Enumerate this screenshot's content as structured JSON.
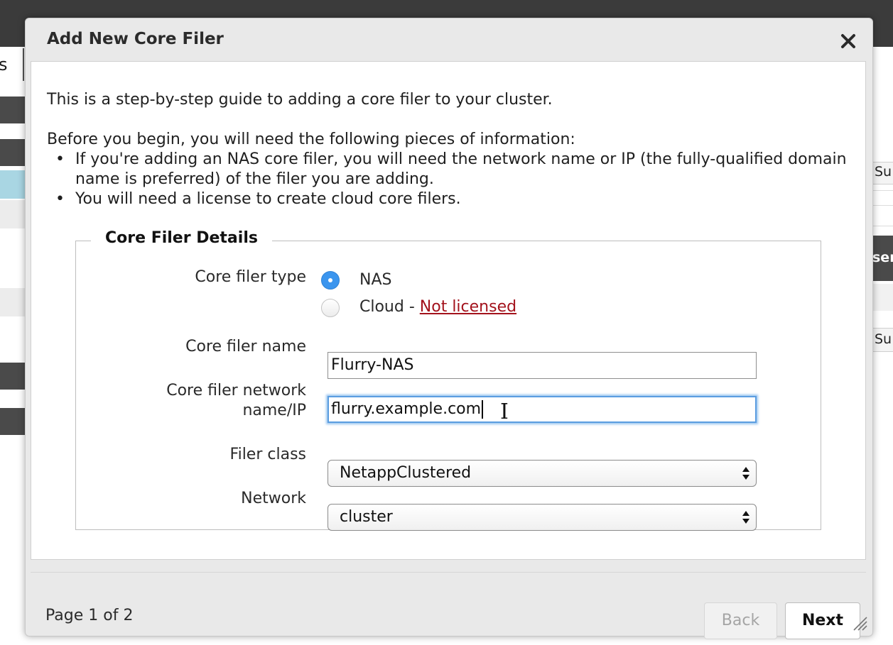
{
  "background": {
    "tab_partial": "s",
    "right_labels": [
      "Su",
      "ser",
      "Su"
    ]
  },
  "dialog": {
    "title": "Add New Core Filer",
    "close_icon": "close-icon",
    "intro": "This is a step-by-step guide to adding a core filer to your cluster.",
    "before_you_begin": "Before you begin, you will need the following pieces of information:",
    "bullets": [
      "If you're adding an NAS core filer, you will need the network name or IP (the fully-qualified domain name is preferred) of the filer you are adding.",
      "You will need a license to create cloud core filers."
    ],
    "fieldset": {
      "legend": "Core Filer Details",
      "core_filer_type": {
        "label": "Core filer type",
        "options": [
          {
            "label": "NAS",
            "selected": true
          },
          {
            "label": "Cloud - ",
            "link": "Not licensed",
            "selected": false
          }
        ]
      },
      "core_filer_name": {
        "label": "Core filer name",
        "value": "Flurry-NAS"
      },
      "network_name": {
        "label_line1": "Core filer network",
        "label_line2": "name/IP",
        "value": "flurry.example.com"
      },
      "filer_class": {
        "label": "Filer class",
        "value": "NetappClustered"
      },
      "network": {
        "label": "Network",
        "value": "cluster"
      }
    }
  },
  "footer": {
    "page_indicator": "Page 1 of 2",
    "back_label": "Back",
    "back_disabled": true,
    "next_label": "Next"
  },
  "colors": {
    "radio_selected": "#3b95ee",
    "link": "#a3121c",
    "focus_ring": "#5b9de0"
  }
}
